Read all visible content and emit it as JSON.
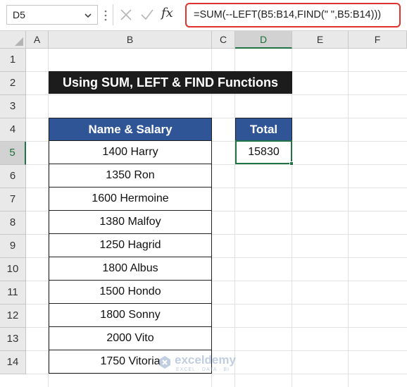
{
  "formula_bar": {
    "name_box": "D5",
    "cancel_icon": "close-icon",
    "enter_icon": "check-icon",
    "fx_label": "fx",
    "formula": "=SUM(--LEFT(B5:B14,FIND(\" \",B5:B14)))",
    "highlight_color": "#e0322e"
  },
  "columns": [
    "A",
    "B",
    "C",
    "D",
    "E",
    "F"
  ],
  "rows": [
    "1",
    "2",
    "3",
    "4",
    "5",
    "6",
    "7",
    "8",
    "9",
    "10",
    "11",
    "12",
    "13",
    "14"
  ],
  "selected_cell": {
    "column": "D",
    "row": "5"
  },
  "sheet": {
    "title": "Using SUM, LEFT & FIND Functions",
    "table_header": "Name & Salary",
    "table_rows": [
      "1400 Harry",
      "1350 Ron",
      "1600 Hermoine",
      "1380 Malfoy",
      "1250 Hagrid",
      "1800 Albus",
      "1500 Hondo",
      "1800 Sonny",
      "2000 Vito",
      "1750 Vitoria"
    ],
    "total_header": "Total",
    "total_value": "15830"
  },
  "colors": {
    "header_fill": "#2f5597",
    "title_fill": "#1c1c1c",
    "selection": "#217346"
  },
  "watermark": {
    "name": "exceldemy",
    "tagline": "EXCEL · DATA · BI"
  }
}
